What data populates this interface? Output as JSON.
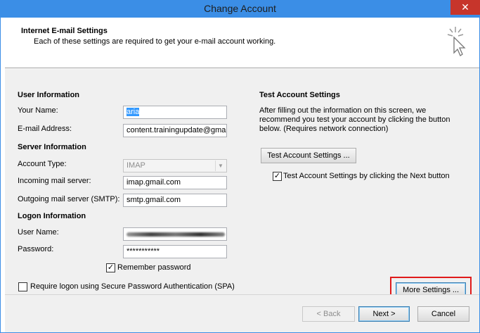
{
  "window": {
    "title": "Change Account",
    "close_glyph": "✕"
  },
  "header": {
    "title": "Internet E-mail Settings",
    "description": "Each of these settings are required to get your e-mail account working."
  },
  "user_info": {
    "section": "User Information",
    "name_label": "Your Name:",
    "name_value": "aria",
    "email_label": "E-mail Address:",
    "email_value": "content.trainingupdate@gmail"
  },
  "server_info": {
    "section": "Server Information",
    "account_type_label": "Account Type:",
    "account_type_value": "IMAP",
    "incoming_label": "Incoming mail server:",
    "incoming_value": "imap.gmail.com",
    "outgoing_label": "Outgoing mail server (SMTP):",
    "outgoing_value": "smtp.gmail.com"
  },
  "logon_info": {
    "section": "Logon Information",
    "username_label": "User Name:",
    "password_label": "Password:",
    "password_value": "***********",
    "remember_label": "Remember password",
    "remember_checked": true,
    "spa_label": "Require logon using Secure Password Authentication (SPA)",
    "spa_checked": false
  },
  "test_settings": {
    "section": "Test Account Settings",
    "description": "After filling out the information on this screen, we recommend you test your account by clicking the button below. (Requires network connection)",
    "test_button": "Test Account Settings ...",
    "auto_test_label": "Test Account Settings by clicking the Next button",
    "auto_test_checked": true
  },
  "buttons": {
    "more_settings": "More Settings ...",
    "back": "< Back",
    "next": "Next >",
    "cancel": "Cancel"
  },
  "colors": {
    "titlebar": "#3b8ee6",
    "close": "#c7352b",
    "highlight": "#e01a1a"
  }
}
